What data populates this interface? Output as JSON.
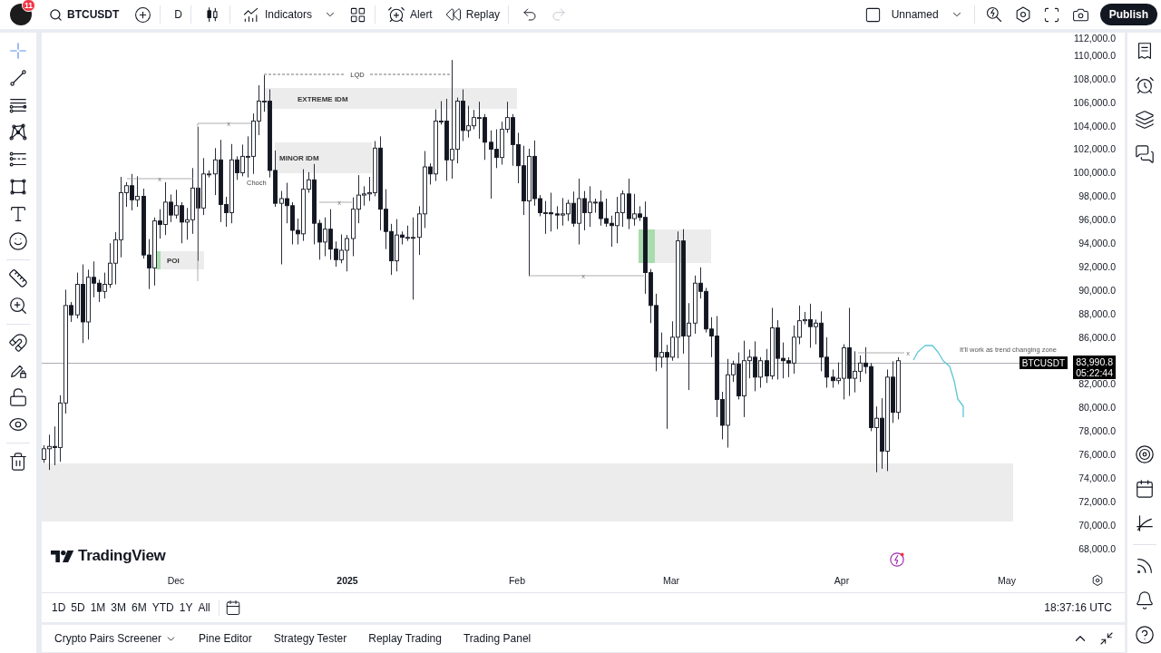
{
  "top_bar": {
    "notification_count": "11",
    "symbol": "BTCUSDT",
    "interval": "D",
    "indicators": "Indicators",
    "alert": "Alert",
    "replay": "Replay",
    "history": [
      {
        "disabled": false
      },
      {
        "disabled": true
      }
    ],
    "layout_name": "Unnamed",
    "publish": "Publish"
  },
  "drawing_tools": [
    {
      "selected": true
    },
    {
      "selected": false
    },
    {
      "selected": false
    },
    {
      "selected": false
    },
    {
      "selected": false
    },
    {
      "selected": false
    },
    {
      "selected": false
    },
    {
      "selected": false
    },
    {
      "selected": false
    },
    {
      "selected": false
    },
    {
      "selected": false
    },
    {
      "selected": false
    },
    {
      "selected": false
    },
    {
      "selected": false
    },
    {
      "selected": false
    }
  ],
  "chart": {
    "symbol_tag": "BTCUSDT",
    "last_price": "83,990.8",
    "countdown": "05:22:44",
    "price_axis": [
      "112,000.0",
      "110,000.0",
      "108,000.0",
      "106,000.0",
      "104,000.0",
      "102,000.0",
      "100,000.0",
      "98,000.0",
      "96,000.0",
      "94,000.0",
      "92,000.0",
      "90,000.0",
      "88,000.0",
      "86,000.0",
      "82,000.0",
      "80,000.0",
      "78,000.0",
      "76,000.0",
      "74,000.0",
      "72,000.0",
      "70,000.0",
      "68,000.0"
    ],
    "time_axis": [
      {
        "label": "Dec",
        "kind": "month"
      },
      {
        "label": "2025",
        "kind": "year"
      },
      {
        "label": "Feb",
        "kind": "month"
      },
      {
        "label": "Mar",
        "kind": "month"
      },
      {
        "label": "Apr",
        "kind": "month"
      },
      {
        "label": "May",
        "kind": "month"
      }
    ],
    "annotations": [
      {
        "kind": "dashed-line",
        "label": "LQD"
      },
      {
        "kind": "zone",
        "label": "EXTREME IDM"
      },
      {
        "kind": "zone",
        "label": "MINOR IDM"
      },
      {
        "kind": "text",
        "label": "Choch"
      },
      {
        "kind": "zone",
        "label": "POI"
      },
      {
        "kind": "zone"
      },
      {
        "kind": "zone"
      },
      {
        "kind": "marked-line",
        "label": "x"
      },
      {
        "kind": "marked-line",
        "label": "x"
      },
      {
        "kind": "marked-line",
        "label": "x"
      },
      {
        "kind": "marked-line",
        "label": "x"
      },
      {
        "kind": "marked-line",
        "label": "x"
      },
      {
        "kind": "text",
        "label": "It'll work as trend changing zone"
      },
      {
        "kind": "path"
      }
    ],
    "brand": "TradingView"
  },
  "time_range": {
    "ranges": [
      "1D",
      "5D",
      "1M",
      "3M",
      "6M",
      "YTD",
      "1Y",
      "All"
    ],
    "clock": "18:37:16 UTC"
  },
  "bottom_panel": {
    "tabs": [
      {
        "label": "Crypto Pairs Screener",
        "has_menu": true
      },
      {
        "label": "Pine Editor",
        "has_menu": false
      },
      {
        "label": "Strategy Tester",
        "has_menu": false
      },
      {
        "label": "Replay Trading",
        "has_menu": false
      },
      {
        "label": "Trading Panel",
        "has_menu": false
      }
    ]
  }
}
